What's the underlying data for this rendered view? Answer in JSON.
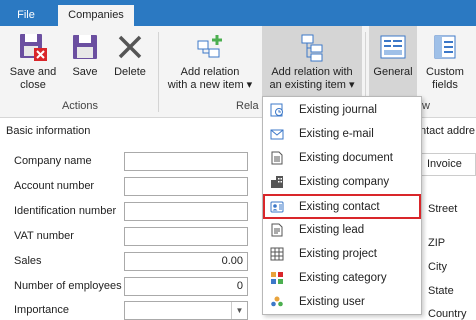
{
  "tabs": {
    "file": "File",
    "companies": "Companies"
  },
  "ribbon": {
    "save_and_close": "Save and\nclose",
    "save": "Save",
    "delete": "Delete",
    "add_relation_new": "Add relation\nwith a new item ▾",
    "add_relation_existing": "Add relation with\nan existing item ▾",
    "general": "General",
    "custom_fields": "Custom\nfields",
    "group_actions": "Actions",
    "group_relations": "Rela",
    "group_view": "w"
  },
  "form": {
    "section_title": "Basic information",
    "fields": [
      {
        "label": "Company name",
        "value": ""
      },
      {
        "label": "Account number",
        "value": ""
      },
      {
        "label": "Identification number",
        "value": ""
      },
      {
        "label": "VAT number",
        "value": ""
      },
      {
        "label": "Sales",
        "value": "0.00"
      },
      {
        "label": "Number of employees",
        "value": "0"
      },
      {
        "label": "Importance",
        "value": ""
      }
    ]
  },
  "right_panel": {
    "header": "ntact addre",
    "tab": "Invoice",
    "labels": [
      "Street",
      "ZIP",
      "City",
      "State",
      "Country"
    ]
  },
  "menu": {
    "items": [
      {
        "label": "Existing journal",
        "icon": "journal-icon"
      },
      {
        "label": "Existing e-mail",
        "icon": "email-icon"
      },
      {
        "label": "Existing document",
        "icon": "document-icon"
      },
      {
        "label": "Existing company",
        "icon": "company-icon"
      },
      {
        "label": "Existing contact",
        "icon": "contact-icon",
        "highlighted": true
      },
      {
        "label": "Existing lead",
        "icon": "lead-icon"
      },
      {
        "label": "Existing project",
        "icon": "project-icon"
      },
      {
        "label": "Existing category",
        "icon": "category-icon"
      },
      {
        "label": "Existing user",
        "icon": "user-icon"
      }
    ]
  },
  "colors": {
    "tabbar": "#2b79c2",
    "highlight_border": "#d9262a",
    "icon_blue": "#3c78c8",
    "icon_green": "#4caf50"
  }
}
